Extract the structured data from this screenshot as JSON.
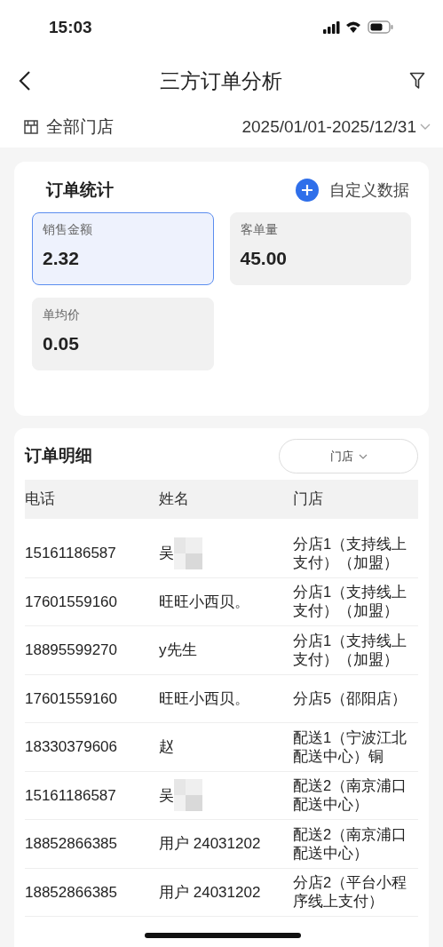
{
  "status_bar": {
    "time": "15:03"
  },
  "nav": {
    "title": "三方订单分析"
  },
  "filter_bar": {
    "store": "全部门店",
    "date_range": "2025/01/01-2025/12/31"
  },
  "stats": {
    "title": "订单统计",
    "action": "自定义数据",
    "cards": [
      {
        "label": "销售金额",
        "value": "2.32",
        "selected": true
      },
      {
        "label": "客单量",
        "value": "45.00",
        "selected": false
      },
      {
        "label": "单均价",
        "value": "0.05",
        "selected": false
      }
    ]
  },
  "details": {
    "title": "订单明细",
    "store_filter": "门店",
    "columns": [
      "电话",
      "姓名",
      "门店"
    ],
    "rows": [
      {
        "phone": "15161186587",
        "name": "吴",
        "redacted": true,
        "store": "分店1（支持线上支付）（加盟）"
      },
      {
        "phone": "17601559160",
        "name": "旺旺小西贝。",
        "redacted": false,
        "store": "分店1（支持线上支付）（加盟）"
      },
      {
        "phone": "18895599270",
        "name": "y先生",
        "redacted": false,
        "store": "分店1（支持线上支付）（加盟）"
      },
      {
        "phone": "17601559160",
        "name": "旺旺小西贝。",
        "redacted": false,
        "store": "分店5（邵阳店）"
      },
      {
        "phone": "18330379606",
        "name": "赵",
        "redacted": false,
        "store": "配送1（宁波江北配送中心）铜"
      },
      {
        "phone": "15161186587",
        "name": "吴",
        "redacted": true,
        "store": "配送2（南京浦口配送中心）"
      },
      {
        "phone": "18852866385",
        "name": "用户 24031202",
        "redacted": false,
        "store": "配送2（南京浦口配送中心）"
      },
      {
        "phone": "18852866385",
        "name": "用户 24031202",
        "redacted": false,
        "store": "分店2（平台小程序线上支付）"
      }
    ]
  }
}
